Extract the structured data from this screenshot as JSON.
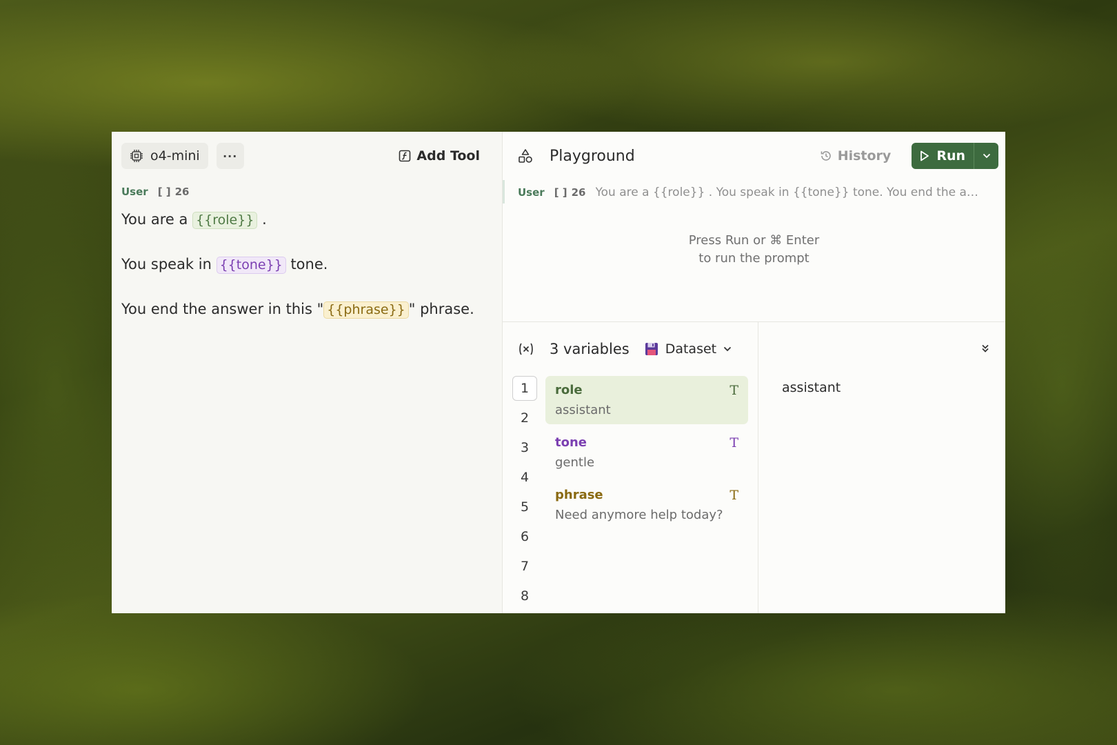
{
  "left_panel": {
    "model": "o4-mini",
    "more_label": "···",
    "add_tool_label": "Add Tool",
    "message": {
      "role": "User",
      "token_count": "26",
      "lines": [
        {
          "before": "You are a ",
          "var": "{{role}}",
          "after": " ."
        },
        {
          "before": "You speak in ",
          "var": "{{tone}}",
          "after": " tone."
        },
        {
          "before": "You end the answer in this \"",
          "var": "{{phrase}}",
          "after": "\" phrase."
        }
      ]
    }
  },
  "playground": {
    "title": "Playground",
    "history_label": "History",
    "run_label": "Run",
    "preview": {
      "role": "User",
      "token_count": "26",
      "text": "You are a {{role}} . You speak in {{tone}} tone. You end the an..."
    },
    "hint_line1": "Press Run or ⌘ Enter",
    "hint_line2": "to run the prompt"
  },
  "variables": {
    "count_label": "3 variables",
    "dataset_label": "Dataset",
    "rows": [
      "1",
      "2",
      "3",
      "4",
      "5",
      "6",
      "7",
      "8"
    ],
    "active_row": "1",
    "items": [
      {
        "name": "role",
        "value": "assistant",
        "type": "T",
        "color": "#4a6b3c"
      },
      {
        "name": "tone",
        "value": "gentle",
        "type": "T",
        "color": "#7b3fb1"
      },
      {
        "name": "phrase",
        "value": "Need anymore help today?",
        "type": "T",
        "color": "#8a6a12"
      }
    ],
    "selected_value": "assistant"
  },
  "colors": {
    "run_button": "#3d6b3f",
    "role_accent": "#4a7a5a"
  }
}
